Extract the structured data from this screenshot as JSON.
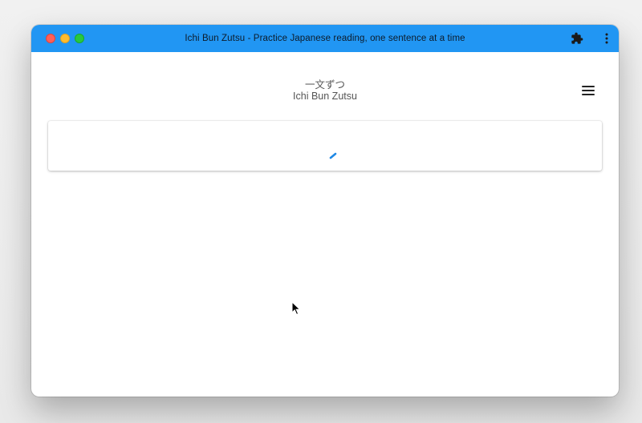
{
  "window": {
    "title": "Ichi Bun Zutsu - Practice Japanese reading, one sentence at a time",
    "titlebar_color": "#2196f3"
  },
  "toolbar_icons": {
    "extension": "puzzle-piece-icon",
    "menu": "more-vertical-icon"
  },
  "header": {
    "title_ja": "一文ずつ",
    "title_en": "Ichi Bun Zutsu",
    "menu_icon": "hamburger-menu-icon"
  },
  "content": {
    "loading_indicator": "spinner-icon",
    "accent_color": "#1e88e5"
  }
}
